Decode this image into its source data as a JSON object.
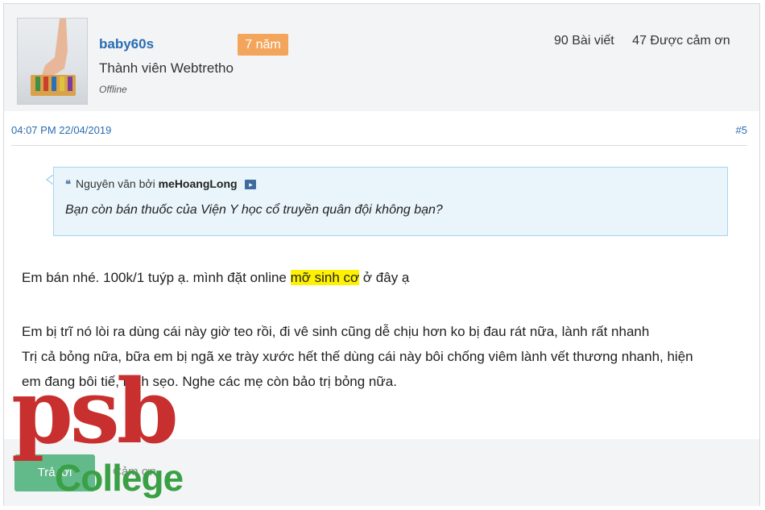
{
  "user": {
    "username": "baby60s",
    "badge": "7 năm",
    "title": "Thành viên Webtretho",
    "status": "Offline",
    "posts": "90 Bài viết",
    "thanks": "47 Được cảm ơn",
    "avatar_icon": "foot-massager-avatar"
  },
  "post": {
    "timestamp": "04:07 PM 22/04/2019",
    "number": "#5",
    "quote": {
      "prefix": "Nguyên văn bởi",
      "author": "meHoangLong",
      "text": "Bạn còn bán thuốc của Viện Y học cổ truyền quân đội không bạn?"
    },
    "body": {
      "line1_before": "Em bán nhé. 100k/1 tuýp ạ. mình đặt online ",
      "line1_highlight": "mỡ sinh cơ",
      "line1_after": " ở đây ạ",
      "line2": "Em bị trĩ nó lòi ra dùng cái này giờ teo rồi, đi vê sinh cũng dễ chịu hơn ko bị đau rát nữa, lành rất nhanh",
      "line3": "Trị cả bỏng nữa, bữa em bị ngã xe trày xước hết thế dùng cái này bôi chống viêm lành vết thương nhanh, hiện",
      "line4": "em đang bôi tiế, lành sẹo. Nghe các mẹ còn bảo trị bỏng nữa."
    }
  },
  "actions": {
    "reply": "Trả lời",
    "thank": "Cảm ơn"
  },
  "watermark": {
    "psb": "psb",
    "college": "College"
  },
  "colors": {
    "link_blue": "#2a6cb0",
    "badge_orange": "#f3a55c",
    "highlight": "#fff200",
    "logo_red": "#c8302f",
    "logo_green": "#3aa046"
  }
}
